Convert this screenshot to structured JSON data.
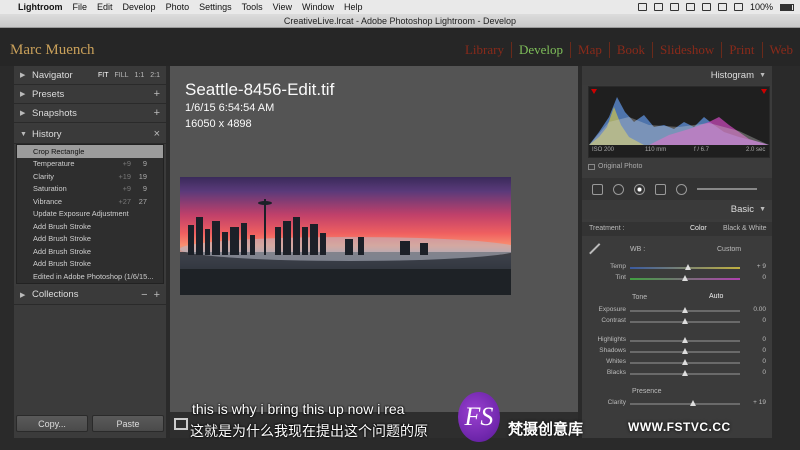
{
  "menubar": {
    "app_name": "Lightroom",
    "items": [
      "File",
      "Edit",
      "Develop",
      "Photo",
      "Settings",
      "Tools",
      "View",
      "Window",
      "Help"
    ],
    "battery": "100%"
  },
  "window": {
    "title": "CreativeLive.lrcat - Adobe Photoshop Lightroom - Develop"
  },
  "identity_plate": "Marc Muench",
  "modules": [
    {
      "label": "Library",
      "active": false
    },
    {
      "label": "Develop",
      "active": true
    },
    {
      "label": "Map",
      "active": false
    },
    {
      "label": "Book",
      "active": false
    },
    {
      "label": "Slideshow",
      "active": false
    },
    {
      "label": "Print",
      "active": false
    },
    {
      "label": "Web",
      "active": false
    }
  ],
  "left_panel": {
    "navigator": {
      "label": "Navigator",
      "zoom_options": [
        "FIT",
        "FILL",
        "1:1",
        "2:1"
      ]
    },
    "presets": {
      "label": "Presets"
    },
    "snapshots": {
      "label": "Snapshots"
    },
    "history": {
      "label": "History",
      "items": [
        {
          "name": "Crop Rectangle",
          "a": "",
          "b": ""
        },
        {
          "name": "Temperature",
          "a": "+9",
          "b": "9"
        },
        {
          "name": "Clarity",
          "a": "+19",
          "b": "19"
        },
        {
          "name": "Saturation",
          "a": "+9",
          "b": "9"
        },
        {
          "name": "Vibrance",
          "a": "+27",
          "b": "27"
        },
        {
          "name": "Update Exposure Adjustment",
          "a": "",
          "b": ""
        },
        {
          "name": "Add Brush Stroke",
          "a": "",
          "b": ""
        },
        {
          "name": "Add Brush Stroke",
          "a": "",
          "b": ""
        },
        {
          "name": "Add Brush Stroke",
          "a": "",
          "b": ""
        },
        {
          "name": "Add Brush Stroke",
          "a": "",
          "b": ""
        },
        {
          "name": "Edited in Adobe Photoshop (1/6/15...",
          "a": "",
          "b": ""
        }
      ]
    },
    "collections": {
      "label": "Collections"
    },
    "copy_label": "Copy...",
    "paste_label": "Paste"
  },
  "center": {
    "filename": "Seattle-8456-Edit.tif",
    "datetime": "1/6/15 6:54:54 AM",
    "dimensions": "16050 x 4898"
  },
  "right_panel": {
    "histogram_label": "Histogram",
    "iso": "ISO 200",
    "focal": "110 mm",
    "aperture": "f / 6.7",
    "shutter": "2.0 sec",
    "original_photo": "Original Photo",
    "basic_label": "Basic",
    "treatment_label": "Treatment :",
    "treatment_color": "Color",
    "treatment_bw": "Black & White",
    "wb_label": "WB :",
    "wb_value": "Custom",
    "tone_label": "Tone",
    "auto_label": "Auto",
    "presence_label": "Presence",
    "sliders": {
      "temp": {
        "label": "Temp",
        "value": "+ 9"
      },
      "tint": {
        "label": "Tint",
        "value": "0"
      },
      "exposure": {
        "label": "Exposure",
        "value": "0.00"
      },
      "contrast": {
        "label": "Contrast",
        "value": "0"
      },
      "highlights": {
        "label": "Highlights",
        "value": "0"
      },
      "shadows": {
        "label": "Shadows",
        "value": "0"
      },
      "whites": {
        "label": "Whites",
        "value": "0"
      },
      "blacks": {
        "label": "Blacks",
        "value": "0"
      },
      "clarity": {
        "label": "Clarity",
        "value": "+ 19"
      }
    }
  },
  "subtitles": {
    "en": "this is why i bring this up now i rea",
    "cn": "这就是为什么我现在提出这个问题的原"
  },
  "watermark": {
    "logo": "FS",
    "text": "梵摄创意库",
    "url": "WWW.FSTVC.CC"
  }
}
